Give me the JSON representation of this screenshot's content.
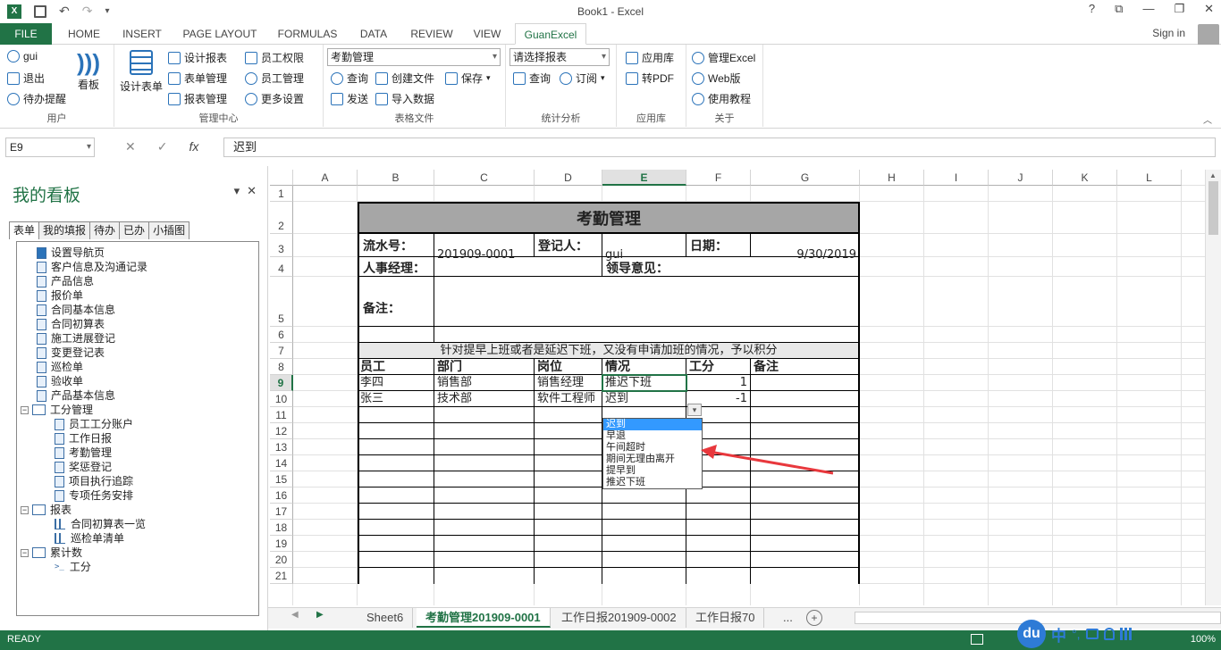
{
  "window": {
    "title": "Book1 - Excel",
    "help": "?",
    "restore": "⧉",
    "minimize": "—",
    "maximize": "❐",
    "close": "✕"
  },
  "tabs": [
    "FILE",
    "HOME",
    "INSERT",
    "PAGE LAYOUT",
    "FORMULAS",
    "DATA",
    "REVIEW",
    "VIEW",
    "GuanExcel"
  ],
  "signin": "Sign in",
  "ribbon": {
    "user": {
      "label": "用户",
      "items": [
        "gui",
        "退出",
        "待办提醒"
      ]
    },
    "board": {
      "label": "看板"
    },
    "design": {
      "label": "设计表单"
    },
    "mgmt": {
      "label": "管理中心",
      "items": [
        "设计报表",
        "表单管理",
        "报表管理",
        "员工权限",
        "员工管理",
        "更多设置"
      ]
    },
    "table": {
      "label": "表格文件",
      "combo": "考勤管理",
      "items": [
        "查询",
        "创建文件",
        "保存",
        "发送",
        "导入数据"
      ]
    },
    "stat": {
      "label": "统计分析",
      "combo": "请选择报表",
      "items": [
        "查询",
        "订阅"
      ]
    },
    "app": {
      "label": "应用库",
      "items": [
        "应用库",
        "转PDF"
      ]
    },
    "about": {
      "label": "关于",
      "items": [
        "管理Excel",
        "Web版",
        "使用教程"
      ]
    }
  },
  "formula": {
    "namebox": "E9",
    "cancel": "✕",
    "enter": "✓",
    "fx": "fx",
    "value": "迟到"
  },
  "pane": {
    "title": "我的看板",
    "tabs": [
      "表单",
      "我的填报",
      "待办",
      "已办",
      "小插图"
    ],
    "tree": [
      {
        "t": "设置导航页",
        "lvl": 1,
        "k": "nav"
      },
      {
        "t": "客户信息及沟通记录",
        "lvl": 1,
        "k": "doc"
      },
      {
        "t": "产品信息",
        "lvl": 1,
        "k": "doc"
      },
      {
        "t": "报价单",
        "lvl": 1,
        "k": "doc"
      },
      {
        "t": "合同基本信息",
        "lvl": 1,
        "k": "doc"
      },
      {
        "t": "合同初算表",
        "lvl": 1,
        "k": "doc"
      },
      {
        "t": "施工进展登记",
        "lvl": 1,
        "k": "doc"
      },
      {
        "t": "变更登记表",
        "lvl": 1,
        "k": "doc"
      },
      {
        "t": "巡检单",
        "lvl": 1,
        "k": "doc"
      },
      {
        "t": "验收单",
        "lvl": 1,
        "k": "doc"
      },
      {
        "t": "产品基本信息",
        "lvl": 1,
        "k": "doc"
      },
      {
        "t": "工分管理",
        "lvl": 0,
        "k": "fold"
      },
      {
        "t": "员工工分账户",
        "lvl": 2,
        "k": "doc"
      },
      {
        "t": "工作日报",
        "lvl": 2,
        "k": "doc"
      },
      {
        "t": "考勤管理",
        "lvl": 2,
        "k": "doc"
      },
      {
        "t": "奖惩登记",
        "lvl": 2,
        "k": "doc"
      },
      {
        "t": "项目执行追踪",
        "lvl": 2,
        "k": "doc"
      },
      {
        "t": "专项任务安排",
        "lvl": 2,
        "k": "doc"
      },
      {
        "t": "报表",
        "lvl": 0,
        "k": "fold"
      },
      {
        "t": "合同初算表一览",
        "lvl": 2,
        "k": "chart"
      },
      {
        "t": "巡检单清单",
        "lvl": 2,
        "k": "chart"
      },
      {
        "t": "累计数",
        "lvl": 0,
        "k": "fold"
      },
      {
        "t": "工分",
        "lvl": 2,
        "k": "fx"
      }
    ]
  },
  "columns": [
    "A",
    "B",
    "C",
    "D",
    "E",
    "F",
    "G",
    "H",
    "I",
    "J",
    "K",
    "L"
  ],
  "rows": [
    "1",
    "2",
    "3",
    "4",
    "5",
    "6",
    "7",
    "8",
    "9",
    "10",
    "11",
    "12",
    "13",
    "14",
    "15",
    "16",
    "17",
    "18",
    "19",
    "20",
    "21"
  ],
  "sheet": {
    "title": "考勤管理",
    "serial_label": "流水号：",
    "serial": "201909-0001",
    "recorder_label": "登记人：",
    "recorder": "gui",
    "date_label": "日期：",
    "date": "9/30/2019",
    "hr_label": "人事经理：",
    "leader_label": "领导意见：",
    "remark_label": "备注：",
    "note": "针对提早上班或者是延迟下班，又没有申请加班的情况，予以积分",
    "headers": [
      "员工",
      "部门",
      "岗位",
      "情况",
      "工分",
      "备注"
    ],
    "records": [
      {
        "emp": "李四",
        "dept": "销售部",
        "pos": "销售经理",
        "status": "推迟下班",
        "score": "1"
      },
      {
        "emp": "张三",
        "dept": "技术部",
        "pos": "软件工程师",
        "status": "迟到",
        "score": "-1"
      }
    ]
  },
  "dropdown": {
    "options": [
      "迟到",
      "早退",
      "午间超时",
      "期间无理由离开",
      "提早到",
      "推迟下班"
    ],
    "selected": 0
  },
  "sheets": [
    "Sheet6",
    "考勤管理201909-0001",
    "工作日报201909-0002",
    "工作日报70",
    "..."
  ],
  "status": {
    "ready": "READY",
    "zoom": "100%"
  },
  "ime": {
    "logo": "du",
    "lang": "中",
    "punct": "°,"
  },
  "colors": {
    "accent": "#217346",
    "arrow": "#e8383d",
    "selection": "#3399ff"
  }
}
